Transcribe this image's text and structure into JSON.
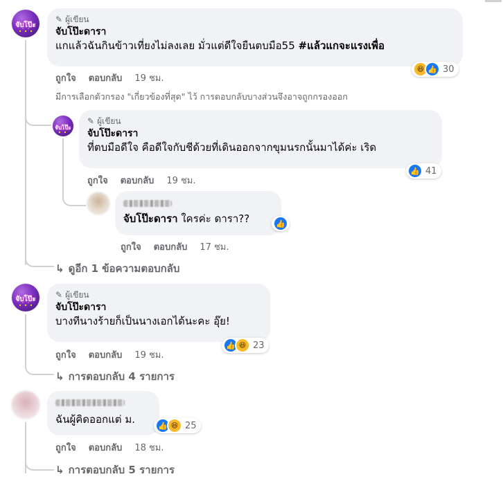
{
  "comments": [
    {
      "badge": "ผู้เขียน",
      "name": "จับโป๊ะดารา",
      "text": "แกแล้วฉันกินข้าวเที่ยงไม่ลงเลย มั่วแต่ดีใจยืนตบมือ55 ",
      "hashtag": "#แล้วแกจะแรงเพื่อ",
      "like": "ถูกใจ",
      "reply": "ตอบกลับ",
      "time": "19 ชม.",
      "reaction_count": "30",
      "reaction_icons": [
        "haha-icon",
        "like-icon"
      ]
    },
    {
      "badge": "ผู้เขียน",
      "name": "จับโป๊ะดารา",
      "text": "ที่ตบมือดีใจ คือดีใจกับชีด้วยที่เดินออกจากขุมนรกนั้นมาได้ค่ะ เริด",
      "like": "ถูกใจ",
      "reply": "ตอบกลับ",
      "time": "19 ชม.",
      "reaction_count": "41",
      "reaction_icons": [
        "like-icon"
      ]
    },
    {
      "mention": "จับโป๊ะดารา",
      "text": " ใครค่ะ ดารา??",
      "like": "ถูกใจ",
      "reply": "ตอบกลับ",
      "time": "17 ชม.",
      "reaction_icons": [
        "like-icon"
      ]
    },
    {
      "badge": "ผู้เขียน",
      "name": "จับโป๊ะดารา",
      "text": "บางทีนางร้ายก็เป็นนางเอกได้นะคะ อุ๊ย!",
      "like": "ถูกใจ",
      "reply": "ตอบกลับ",
      "time": "19 ชม.",
      "reaction_count": "23",
      "reaction_icons": [
        "like-icon",
        "haha-icon"
      ]
    },
    {
      "text": "ฉันผู้คิดออกแต่ ม.",
      "like": "ถูกใจ",
      "reply": "ตอบกลับ",
      "time": "18 ชม.",
      "reaction_count": "25",
      "reaction_icons": [
        "like-icon",
        "haha-icon"
      ]
    }
  ],
  "filter_note": "มีการเลือกตัวกรอง \"เกี่ยวข้องที่สุด\" ไว้ การตอบกลับบางส่วนจึงอาจถูกกรองออก",
  "view_more_reply": "ดูอีก 1 ข้อความตอบกลับ",
  "replies_4": "การตอบกลับ 4 รายการ",
  "replies_5": "การตอบกลับ 5 รายการ",
  "avatar_text": "จับโป๊ะ",
  "colors": {
    "bubble": "#f0f2f5",
    "secondary_text": "#65676b",
    "like_blue": "#1877f2",
    "haha_yellow": "#f7b928"
  }
}
